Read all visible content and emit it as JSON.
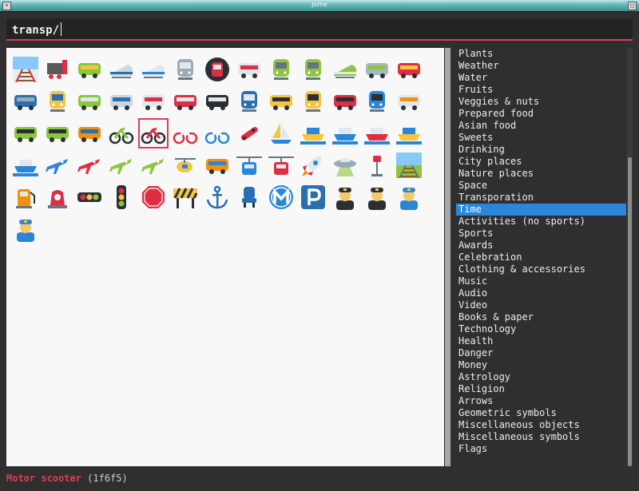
{
  "window": {
    "title": "jome"
  },
  "search": {
    "query": "transp/"
  },
  "emojis": [
    {
      "icon": "roller-coaster-icon",
      "bg": "#e9eef2",
      "fg": "#dd2e44",
      "shape": "track"
    },
    {
      "icon": "locomotive-icon",
      "bg": "#5a5a5a",
      "fg": "#dd2e44",
      "shape": "train"
    },
    {
      "icon": "railway-car-icon",
      "bg": "#8cc63e",
      "fg": "#f4c542",
      "shape": "car"
    },
    {
      "icon": "high-speed-train-icon",
      "bg": "#cfd8dc",
      "fg": "#2a6fb0",
      "shape": "bullet"
    },
    {
      "icon": "bullet-train-icon",
      "bg": "#e1e8ed",
      "fg": "#2a86d8",
      "shape": "bullet"
    },
    {
      "icon": "train-icon",
      "bg": "#99aab5",
      "fg": "#e1e8ed",
      "shape": "front"
    },
    {
      "icon": "metro-icon",
      "bg": "#292f33",
      "fg": "#dd2e44",
      "shape": "circle"
    },
    {
      "icon": "light-rail-icon",
      "bg": "#e1e8ed",
      "fg": "#dd2e44",
      "shape": "car"
    },
    {
      "icon": "station-icon",
      "bg": "#8cc63e",
      "fg": "#66757f",
      "shape": "front"
    },
    {
      "icon": "tram-icon",
      "bg": "#8cc63e",
      "fg": "#66757f",
      "shape": "front"
    },
    {
      "icon": "monorail-icon",
      "bg": "#8cc63e",
      "fg": "#e1e8ed",
      "shape": "bullet"
    },
    {
      "icon": "mountain-railway-icon",
      "bg": "#aab8c2",
      "fg": "#8cc63e",
      "shape": "car"
    },
    {
      "icon": "tram-car-icon",
      "bg": "#dd2e44",
      "fg": "#f4c542",
      "shape": "car"
    },
    {
      "icon": "bus-icon",
      "bg": "#2a6fb0",
      "fg": "#99aab5",
      "shape": "car"
    },
    {
      "icon": "oncoming-bus-icon",
      "bg": "#f4c542",
      "fg": "#2a6fb0",
      "shape": "front"
    },
    {
      "icon": "trolleybus-icon",
      "bg": "#8cc63e",
      "fg": "#e1e8ed",
      "shape": "car"
    },
    {
      "icon": "minibus-icon",
      "bg": "#ccd6dd",
      "fg": "#2a6fb0",
      "shape": "car"
    },
    {
      "icon": "ambulance-icon",
      "bg": "#e1e8ed",
      "fg": "#dd2e44",
      "shape": "car"
    },
    {
      "icon": "fire-engine-icon",
      "bg": "#dd2e44",
      "fg": "#e1e8ed",
      "shape": "car"
    },
    {
      "icon": "police-car-icon",
      "bg": "#292f33",
      "fg": "#e1e8ed",
      "shape": "car"
    },
    {
      "icon": "oncoming-police-car-icon",
      "bg": "#2a6fb0",
      "fg": "#e1e8ed",
      "shape": "front"
    },
    {
      "icon": "taxi-icon",
      "bg": "#f4c542",
      "fg": "#292f33",
      "shape": "car"
    },
    {
      "icon": "oncoming-taxi-icon",
      "bg": "#f4c542",
      "fg": "#292f33",
      "shape": "front"
    },
    {
      "icon": "automobile-icon",
      "bg": "#dd2e44",
      "fg": "#292f33",
      "shape": "car"
    },
    {
      "icon": "oncoming-automobile-icon",
      "bg": "#2a86d8",
      "fg": "#292f33",
      "shape": "front"
    },
    {
      "icon": "sport-utility-vehicle-icon",
      "bg": "#e1e8ed",
      "fg": "#f4900c",
      "shape": "car"
    },
    {
      "icon": "delivery-truck-icon",
      "bg": "#8cc63e",
      "fg": "#292f33",
      "shape": "car"
    },
    {
      "icon": "tractor-icon",
      "bg": "#8cc63e",
      "fg": "#292f33",
      "shape": "car"
    },
    {
      "icon": "racing-car-icon",
      "bg": "#f4900c",
      "fg": "#2a6fb0",
      "shape": "car"
    },
    {
      "icon": "motorcycle-icon",
      "bg": "#8cc63e",
      "fg": "#292f33",
      "shape": "bike"
    },
    {
      "icon": "motor-scooter-icon",
      "bg": "#dd2e44",
      "fg": "#292f33",
      "shape": "bike",
      "selected": true
    },
    {
      "icon": "bicycle-icon",
      "bg": "#f8f8f8",
      "fg": "#dd2e44",
      "shape": "bike"
    },
    {
      "icon": "kick-scooter-icon",
      "bg": "#f8f8f8",
      "fg": "#2a86d8",
      "shape": "bike"
    },
    {
      "icon": "skateboard-icon",
      "bg": "#dd2e44",
      "fg": "#292f33",
      "shape": "board"
    },
    {
      "icon": "sailboat-icon",
      "bg": "#f4c542",
      "fg": "#2a86d8",
      "shape": "sail"
    },
    {
      "icon": "speedboat-icon",
      "bg": "#2a86d8",
      "fg": "#f4c542",
      "shape": "boat"
    },
    {
      "icon": "passenger-ship-icon",
      "bg": "#e1e8ed",
      "fg": "#2a86d8",
      "shape": "boat"
    },
    {
      "icon": "ferry-icon",
      "bg": "#e1e8ed",
      "fg": "#dd2e44",
      "shape": "boat"
    },
    {
      "icon": "motor-boat-icon",
      "bg": "#2a86d8",
      "fg": "#f4c542",
      "shape": "boat"
    },
    {
      "icon": "ship-icon",
      "bg": "#e1e8ed",
      "fg": "#2a86d8",
      "shape": "boat"
    },
    {
      "icon": "airplane-icon",
      "bg": "#2a86d8",
      "fg": "#2a86d8",
      "shape": "plane"
    },
    {
      "icon": "small-airplane-icon",
      "bg": "#dd2e44",
      "fg": "#dd2e44",
      "shape": "plane"
    },
    {
      "icon": "airplane-departure-icon",
      "bg": "#8cc63e",
      "fg": "#99aab5",
      "shape": "plane"
    },
    {
      "icon": "airplane-arrival-icon",
      "bg": "#8cc63e",
      "fg": "#99aab5",
      "shape": "plane"
    },
    {
      "icon": "helicopter-icon",
      "bg": "#f4c542",
      "fg": "#2a86d8",
      "shape": "heli"
    },
    {
      "icon": "suspension-railway-icon",
      "bg": "#f4900c",
      "fg": "#2a86d8",
      "shape": "car"
    },
    {
      "icon": "mountain-cableway-icon",
      "bg": "#2a86d8",
      "fg": "#f4c542",
      "shape": "cable"
    },
    {
      "icon": "aerial-tramway-icon",
      "bg": "#dd2e44",
      "fg": "#292f33",
      "shape": "cable"
    },
    {
      "icon": "rocket-icon",
      "bg": "#2a86d8",
      "fg": "#dd2e44",
      "shape": "rocket"
    },
    {
      "icon": "flying-saucer-icon",
      "bg": "#99aab5",
      "fg": "#8cc63e",
      "shape": "ufo"
    },
    {
      "icon": "bus-stop-icon",
      "bg": "#66757f",
      "fg": "#dd2e44",
      "shape": "pole"
    },
    {
      "icon": "railway-track-icon",
      "bg": "#8cc63e",
      "fg": "#66757f",
      "shape": "track"
    },
    {
      "icon": "fuel-pump-icon",
      "bg": "#f4900c",
      "fg": "#dd2e44",
      "shape": "pump"
    },
    {
      "icon": "police-car-light-icon",
      "bg": "#dd2e44",
      "fg": "#dd2e44",
      "shape": "light"
    },
    {
      "icon": "horizontal-traffic-light-icon",
      "bg": "#292f33",
      "fg": "#f4c542",
      "shape": "hlight"
    },
    {
      "icon": "vertical-traffic-light-icon",
      "bg": "#292f33",
      "fg": "#f4c542",
      "shape": "vlight"
    },
    {
      "icon": "stop-sign-icon",
      "bg": "#dd2e44",
      "fg": "#dd2e44",
      "shape": "oct"
    },
    {
      "icon": "construction-icon",
      "bg": "#f4c542",
      "fg": "#292f33",
      "shape": "barrier"
    },
    {
      "icon": "anchor-icon",
      "bg": "#f8f8f8",
      "fg": "#2a6fb0",
      "shape": "anchor"
    },
    {
      "icon": "seat-icon",
      "bg": "#f8f8f8",
      "fg": "#2a6fb0",
      "shape": "seat"
    },
    {
      "icon": "metro-sign-icon",
      "bg": "#2a86d8",
      "fg": "#ffffff",
      "shape": "msign"
    },
    {
      "icon": "parking-sign-icon",
      "bg": "#2a6fb0",
      "fg": "#ffffff",
      "shape": "psign"
    },
    {
      "icon": "pilot-icon",
      "bg": "#f5c96b",
      "fg": "#292f33",
      "shape": "person"
    },
    {
      "icon": "woman-pilot-icon",
      "bg": "#f5c96b",
      "fg": "#292f33",
      "shape": "person"
    },
    {
      "icon": "mechanic-icon",
      "bg": "#f5c96b",
      "fg": "#2a86d8",
      "shape": "person"
    },
    {
      "icon": "woman-mechanic-icon",
      "bg": "#f5c96b",
      "fg": "#2a86d8",
      "shape": "person"
    }
  ],
  "categories": [
    "Plants",
    "Weather",
    "Water",
    "Fruits",
    "Veggies & nuts",
    "Prepared food",
    "Asian food",
    "Sweets",
    "Drinking",
    "City places",
    "Nature places",
    "Space",
    "Transporation",
    "Time",
    "Activities (no sports)",
    "Sports",
    "Awards",
    "Celebration",
    "Clothing & accessories",
    "Music",
    "Audio",
    "Video",
    "Books & paper",
    "Technology",
    "Health",
    "Danger",
    "Money",
    "Astrology",
    "Religion",
    "Arrows",
    "Geometric symbols",
    "Miscellaneous objects",
    "Miscellaneous symbols",
    "Flags"
  ],
  "active_category": "Time",
  "status": {
    "name": "Motor scooter",
    "code": "(1f6f5)"
  }
}
